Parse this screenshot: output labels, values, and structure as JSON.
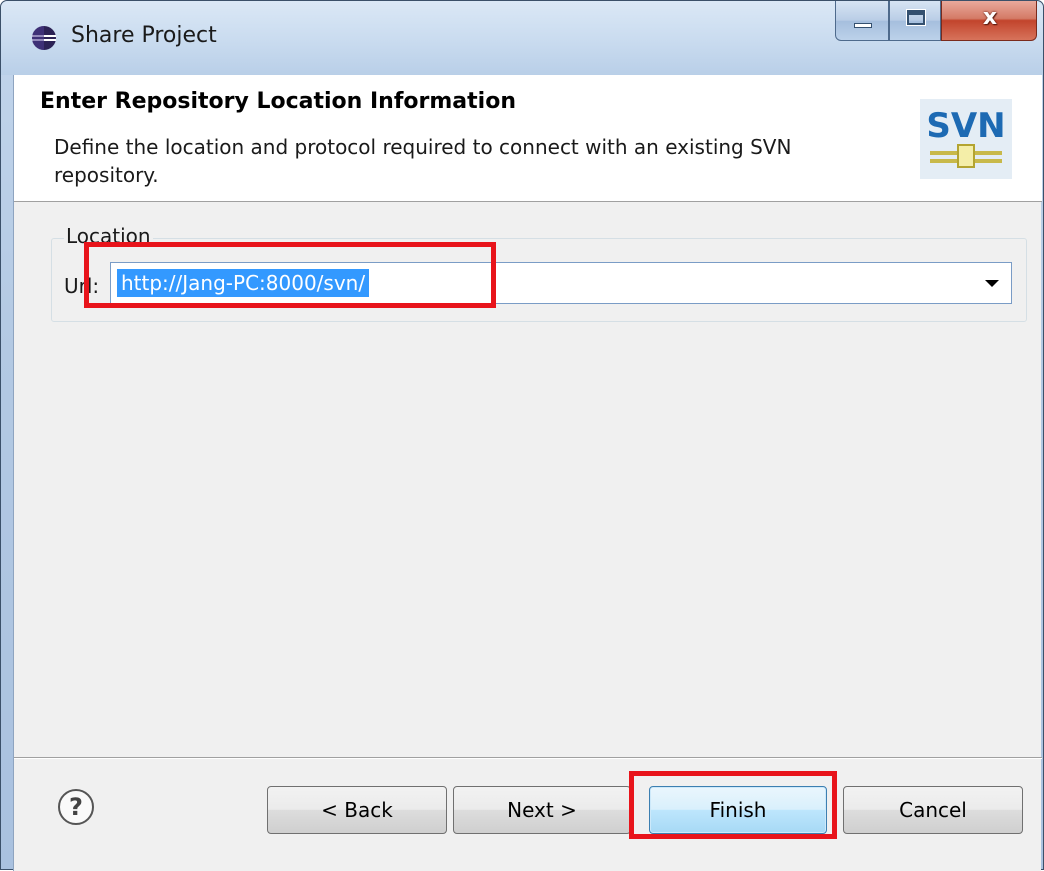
{
  "window": {
    "title": "Share Project",
    "close_glyph": "x",
    "icons": [
      "eclipse-icon",
      "minimize-icon",
      "maximize-icon",
      "close-icon"
    ]
  },
  "banner": {
    "title": "Enter Repository Location Information",
    "description": "Define the location and protocol required to connect with an existing SVN repository.",
    "logo_text": "SVN"
  },
  "location": {
    "legend": "Location",
    "url_label": "Url:",
    "url_value": "http://Jang-PC:8000/svn/"
  },
  "buttons": {
    "help": "?",
    "back": "< Back",
    "next": "Next >",
    "finish": "Finish",
    "cancel": "Cancel"
  },
  "colors": {
    "highlight": "#e8141b",
    "selection": "#3399ff"
  }
}
